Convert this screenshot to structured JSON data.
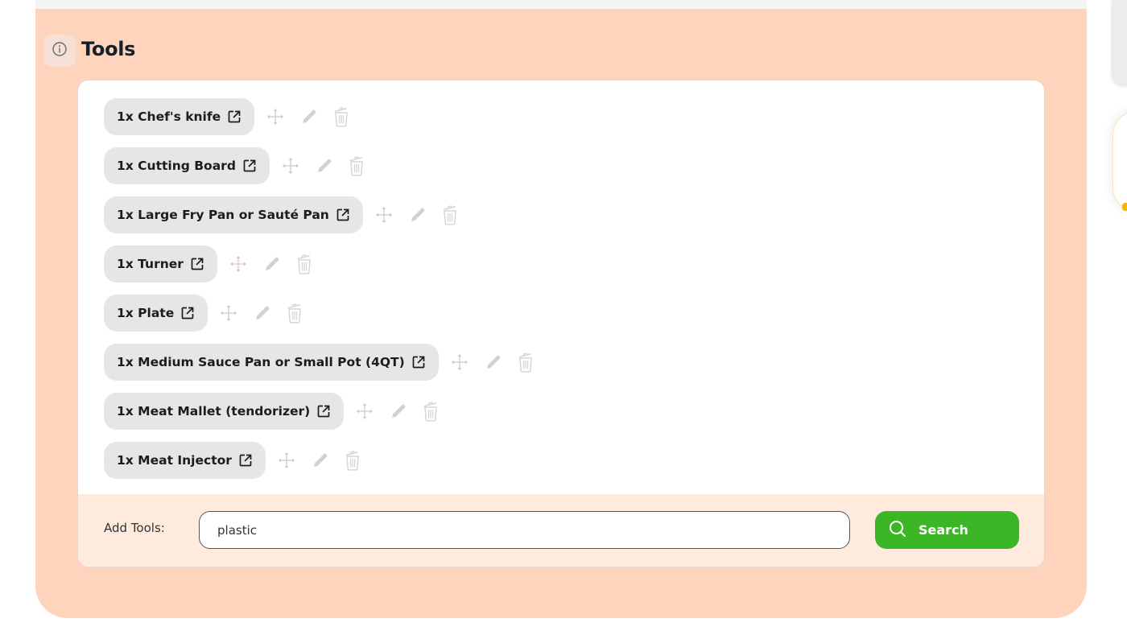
{
  "section": {
    "title": "Tools",
    "info_icon": "info-circle-icon"
  },
  "tools": [
    {
      "label": "1x Chef's knife"
    },
    {
      "label": "1x Cutting Board"
    },
    {
      "label": "1x Large Fry Pan or Sauté Pan"
    },
    {
      "label": "1x Turner"
    },
    {
      "label": "1x Plate"
    },
    {
      "label": "1x Medium Sauce Pan or Small Pot (4QT)"
    },
    {
      "label": "1x Meat Mallet (tendorizer)"
    },
    {
      "label": "1x Meat Injector"
    }
  ],
  "row_icons": {
    "external": "external-link-icon",
    "move": "move-icon",
    "edit": "pencil-icon",
    "delete": "trash-icon"
  },
  "add_tools": {
    "label": "Add Tools:",
    "input_value": "plastic",
    "search_label": "Search"
  },
  "colors": {
    "section_bg": "#fed5bc",
    "add_bar_bg": "#ffebde",
    "chip_bg": "#e6e6e6",
    "search_button": "#3cb626"
  }
}
